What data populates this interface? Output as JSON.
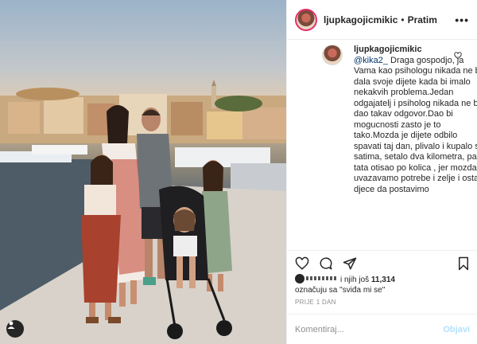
{
  "post": {
    "username": "ljupkagojicmikic",
    "separator": "•",
    "follow_label": "Pratim",
    "more_label": "•••"
  },
  "comment": {
    "username": "ljupkagojicmikic",
    "mention": "@kika2_",
    "text": " Draga gospodjo, ja Vama kao psihologu nikada ne bih dala svoje dijete kada bi imalo nekakvih problema.Jedan odgajatelj i psiholog nikada ne bi dao takav odgovor.Dao bi mogucnosti zasto je to tako.Mozda je dijete odbilo spavati taj dan, plivalo i kupalo se satima, setalo dva kilometra, pa je tata otisao po kolica , jer mozda uvazavamo potrebe i zelje i ostale djece da postavimo"
  },
  "likes": {
    "prefix": "i njih još",
    "count": "11,314",
    "suffix": "označuju sa \"sviđa mi se\""
  },
  "time_ago": "PRIJE 1 DAN",
  "comment_input": {
    "placeholder": "Komentiraj...",
    "post_label": "Objavi"
  },
  "icons": [
    "heart-icon",
    "comment-icon",
    "share-icon",
    "bookmark-icon",
    "user-tag-icon",
    "more-icon"
  ],
  "colors": {
    "follow": "#262626",
    "mention": "#00376b",
    "post_disabled": "#b2dffc",
    "muted": "#8e8e8e"
  }
}
